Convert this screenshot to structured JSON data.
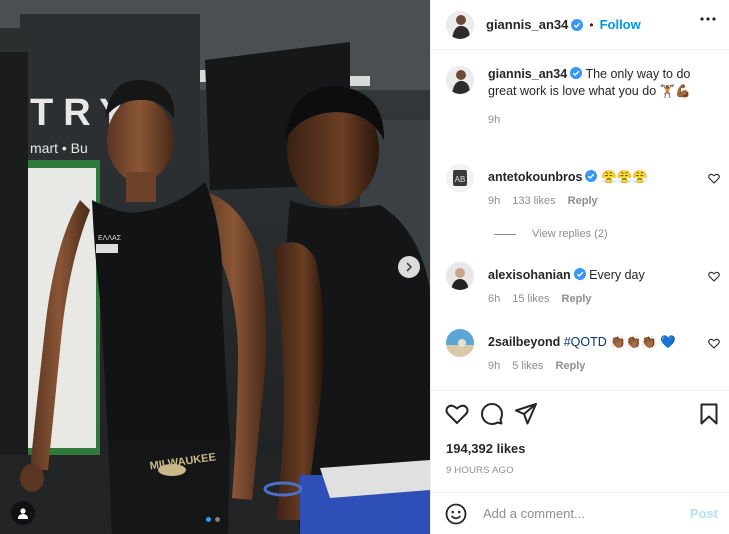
{
  "post": {
    "username": "giannis_an34",
    "follow_label": "Follow",
    "separator": "•",
    "caption": "The only way to do great work is love what you do 🏋🏾💪🏾",
    "caption_time": "9h",
    "likes": "194,392 likes",
    "posted_ago": "9 HOURS AGO",
    "carousel": {
      "current": 1,
      "total": 2
    }
  },
  "comments": [
    {
      "username": "antetokounbros",
      "text": "😤😤😤",
      "time": "9h",
      "likes": "133 likes",
      "reply": "Reply"
    },
    {
      "username": "alexisohanian",
      "text": "Every day",
      "time": "6h",
      "likes": "15 likes",
      "reply": "Reply"
    },
    {
      "username": "2sailbeyond",
      "text": "#QOTD 👏🏾👏🏾👏🏾 💙",
      "time": "9h",
      "likes": "5 likes",
      "reply": "Reply"
    }
  ],
  "view_replies": "View replies (2)",
  "add_comment": {
    "placeholder": "Add a comment...",
    "post_label": "Post"
  },
  "colors": {
    "accent": "#0095f6",
    "verified": "#3897f0",
    "text": "#262626",
    "muted": "#8e8e8e"
  }
}
